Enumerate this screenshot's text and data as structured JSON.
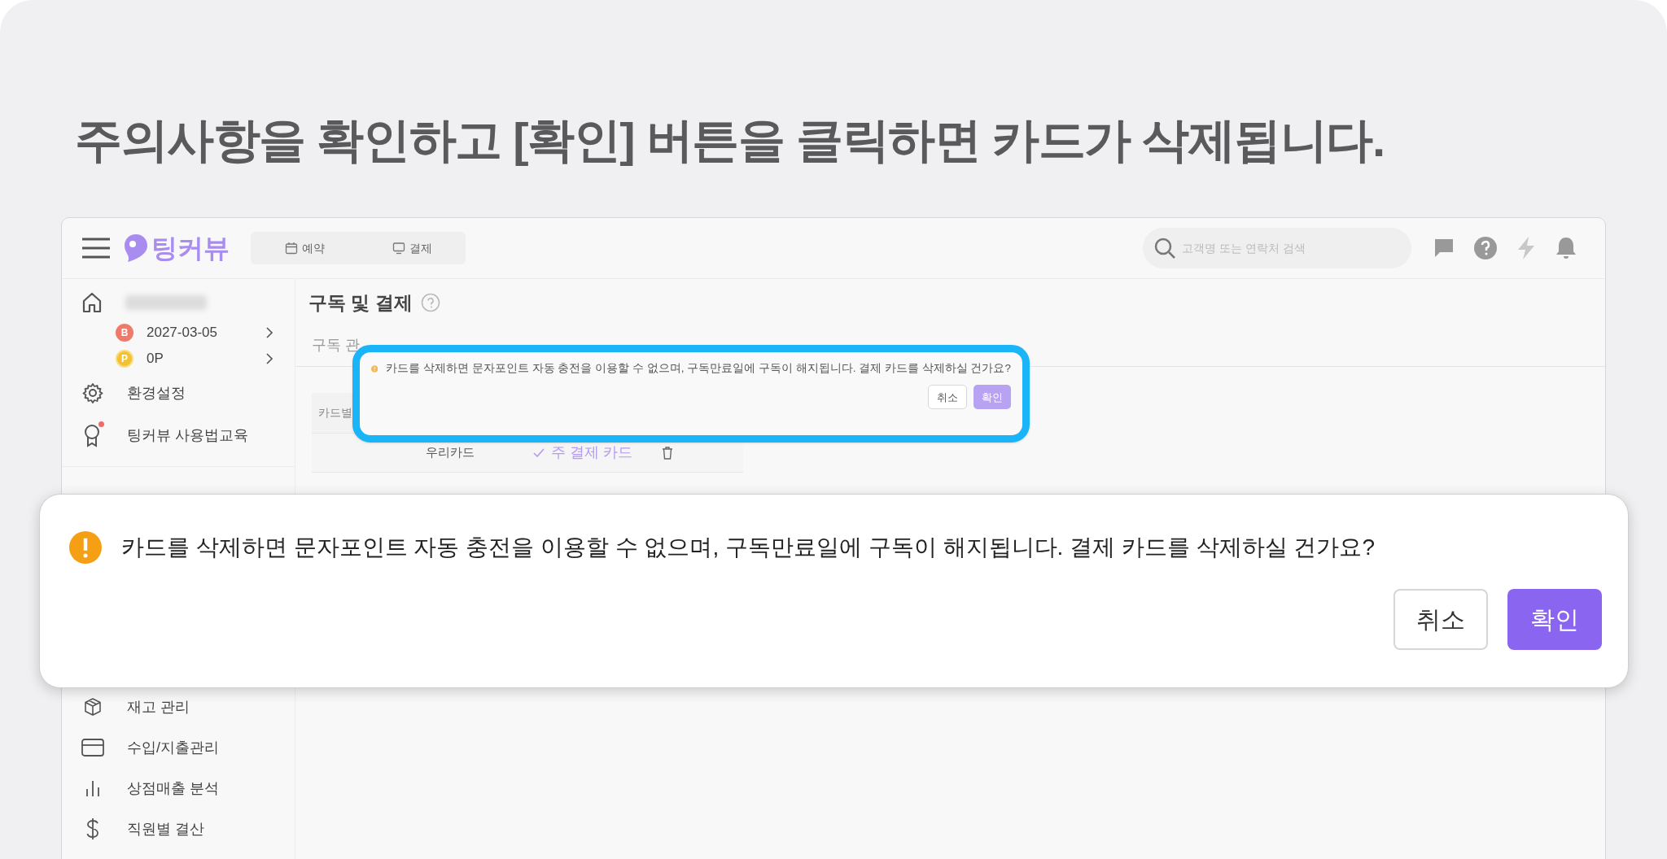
{
  "heading": "주의사항을 확인하고 [확인] 버튼을 클릭하면 카드가 삭제됩니다.",
  "app": {
    "topbar": {
      "logo": "팅커뷰",
      "nav": [
        {
          "label": "예약",
          "kind": "calendar"
        },
        {
          "label": "결제",
          "kind": "payment"
        }
      ],
      "search": {
        "placeholder": "고객명 또는 연락처 검색"
      }
    },
    "sidebar": {
      "account": {
        "plan_badge": "B",
        "expiry": "2027-03-05",
        "points_badge": "P",
        "points": "0P"
      },
      "items_top": [
        {
          "label": "환경설정",
          "kind": "gear",
          "alert": false
        },
        {
          "label": "팅커뷰 사용법교육",
          "kind": "award",
          "alert": true
        }
      ],
      "items_bottom": [
        {
          "label": "재고 관리",
          "kind": "box",
          "alert": false
        },
        {
          "label": "수입/지출관리",
          "kind": "card",
          "alert": false
        },
        {
          "label": "상점매출 분석",
          "kind": "chart",
          "alert": false
        },
        {
          "label": "직원별 결산",
          "kind": "dollar",
          "alert": false
        }
      ]
    },
    "main": {
      "title": "구독 및 결제",
      "tab": "구독 관",
      "table": {
        "header": "카드별",
        "rows": [
          {
            "card": "우리카드",
            "status": "주 결제 카드"
          }
        ]
      }
    },
    "popover": {
      "message": "카드를 삭제하면 문자포인트 자동 충전을 이용할 수 없으며, 구독만료일에 구독이 해지됩니다. 결제 카드를 삭제하실 건가요?",
      "buttons": [
        {
          "label": "취소",
          "kind": "secondary"
        },
        {
          "label": "확인",
          "kind": "primary"
        }
      ]
    }
  },
  "callout": {
    "message": "카드를 삭제하면 문자포인트 자동 충전을 이용할 수 없으며, 구독만료일에 구독이 해지됩니다. 결제 카드를 삭제하실 건가요?",
    "buttons": [
      {
        "label": "취소",
        "kind": "secondary"
      },
      {
        "label": "확인",
        "kind": "primary"
      }
    ]
  }
}
